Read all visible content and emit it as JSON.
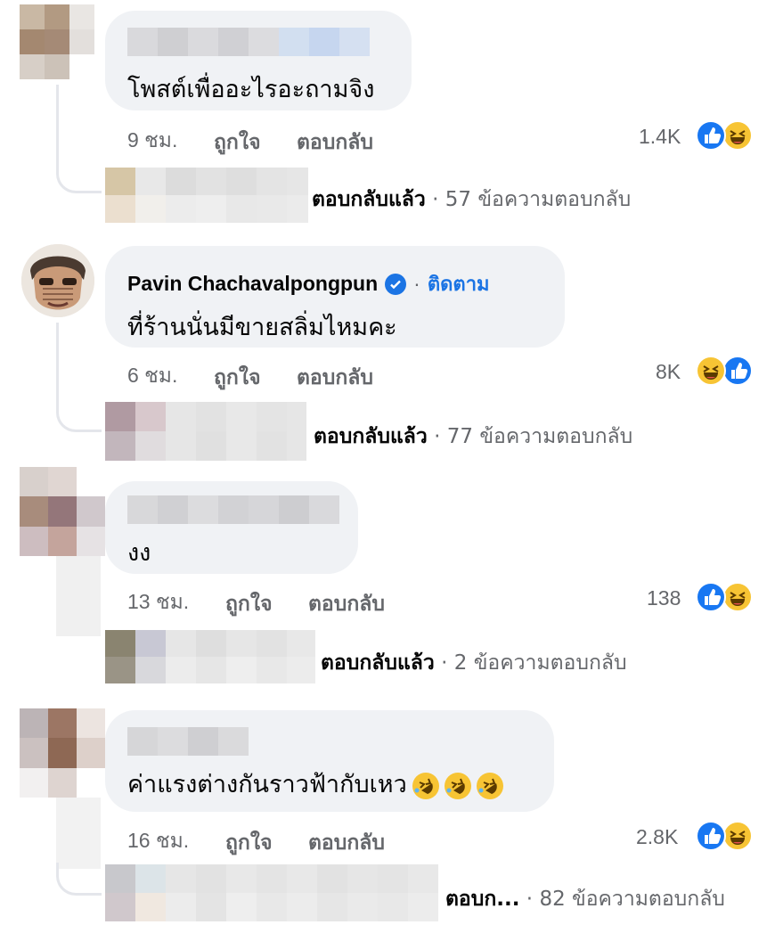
{
  "labels": {
    "like": "ถูกใจ",
    "reply": "ตอบกลับ"
  },
  "colors": {
    "bubble": "#f0f2f5",
    "meta": "#65676b",
    "link": "#1b74e4",
    "like": "#1877f2",
    "haha": "#f7c434"
  },
  "comments": [
    {
      "author": "",
      "text": "โพสต์เพื่ออะไรอะถามจิง",
      "time": "9 ชม.",
      "reaction_count": "1.4K",
      "reactions": [
        "like-icon",
        "haha-icon"
      ],
      "replied_label": "ตอบกลับแล้ว",
      "replies_count": "57 ข้อความตอบกลับ"
    },
    {
      "author": "Pavin Chachavalpongpun",
      "follow": "ติดตาม",
      "text": "ที่ร้านนั่นมีขายสลิ่มไหมคะ",
      "time": "6 ชม.",
      "reaction_count": "8K",
      "reactions": [
        "haha-icon",
        "like-icon"
      ],
      "replied_label": "ตอบกลับแล้ว",
      "replies_count": "77 ข้อความตอบกลับ"
    },
    {
      "author": "",
      "text": "งง",
      "time": "13 ชม.",
      "reaction_count": "138",
      "reactions": [
        "like-icon",
        "haha-icon"
      ],
      "replied_label": "ตอบกลับแล้ว",
      "replies_count": "2 ข้อความตอบกลับ"
    },
    {
      "author": "",
      "text": "ค่าแรงต่างกันราวฟ้ากับเหว",
      "text_emojis": [
        "rofl-emoji",
        "rofl-emoji",
        "rofl-emoji"
      ],
      "time": "16 ชม.",
      "reaction_count": "2.8K",
      "reactions": [
        "like-icon",
        "haha-icon"
      ],
      "replied_label": "ตอบก...",
      "replies_count": "82 ข้อความตอบกลับ"
    }
  ]
}
